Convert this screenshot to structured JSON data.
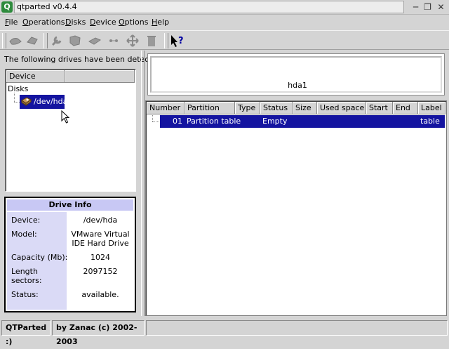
{
  "window": {
    "title": "qtparted v0.4.4",
    "app_icon_letter": "Q"
  },
  "menu": {
    "file": {
      "u": "F",
      "rest": "ile"
    },
    "operations": {
      "u": "O",
      "rest": "perations"
    },
    "disks": {
      "u": "D",
      "rest": "isks"
    },
    "device": {
      "u": "D",
      "rest": "evice"
    },
    "options": {
      "u": "O",
      "rest": "ptions"
    },
    "help": {
      "u": "H",
      "rest": "elp"
    }
  },
  "left": {
    "detected_label": "The following drives have been detected:",
    "tree_header": "Device",
    "disks_label": "Disks",
    "drive": "/dev/hda"
  },
  "drive_info": {
    "title": "Drive Info",
    "device_label": "Device:",
    "device_value": "/dev/hda",
    "model_label": "Model:",
    "model_value_1": "VMware Virtual",
    "model_value_2": "IDE Hard Drive",
    "capacity_label": "Capacity (Mb):",
    "capacity_value": "1024",
    "length_label_1": "Length",
    "length_label_2": "sectors:",
    "length_value": "2097152",
    "status_label": "Status:",
    "status_value": "available."
  },
  "graph": {
    "label": "hda1"
  },
  "table": {
    "columns": [
      "Number",
      "Partition",
      "Type",
      "Status",
      "Size",
      "Used space",
      "Start",
      "End",
      "Label"
    ],
    "row": {
      "number": "01",
      "partition": "Partition table",
      "type": "",
      "status": "Empty",
      "size": "",
      "used": "",
      "start": "",
      "end": "",
      "label": "table"
    }
  },
  "status_bar": {
    "left": "QTParted :)",
    "right": "by Zanac (c) 2002-2003"
  },
  "colors": {
    "selection": "#1414a0",
    "drive_info_title": "#c8c8f4",
    "drive_info_labels": "#dadaf6",
    "app_icon": "#2e8b3d"
  },
  "icons": [
    "app-icon",
    "minimize-icon",
    "restore-icon",
    "close-icon",
    "create-icon",
    "delete-icon",
    "properties-icon",
    "resize-icon",
    "format-icon",
    "cut-icon",
    "move-icon",
    "trash-icon",
    "help-what-icon",
    "hard-disk-icon",
    "mouse-cursor-icon"
  ]
}
